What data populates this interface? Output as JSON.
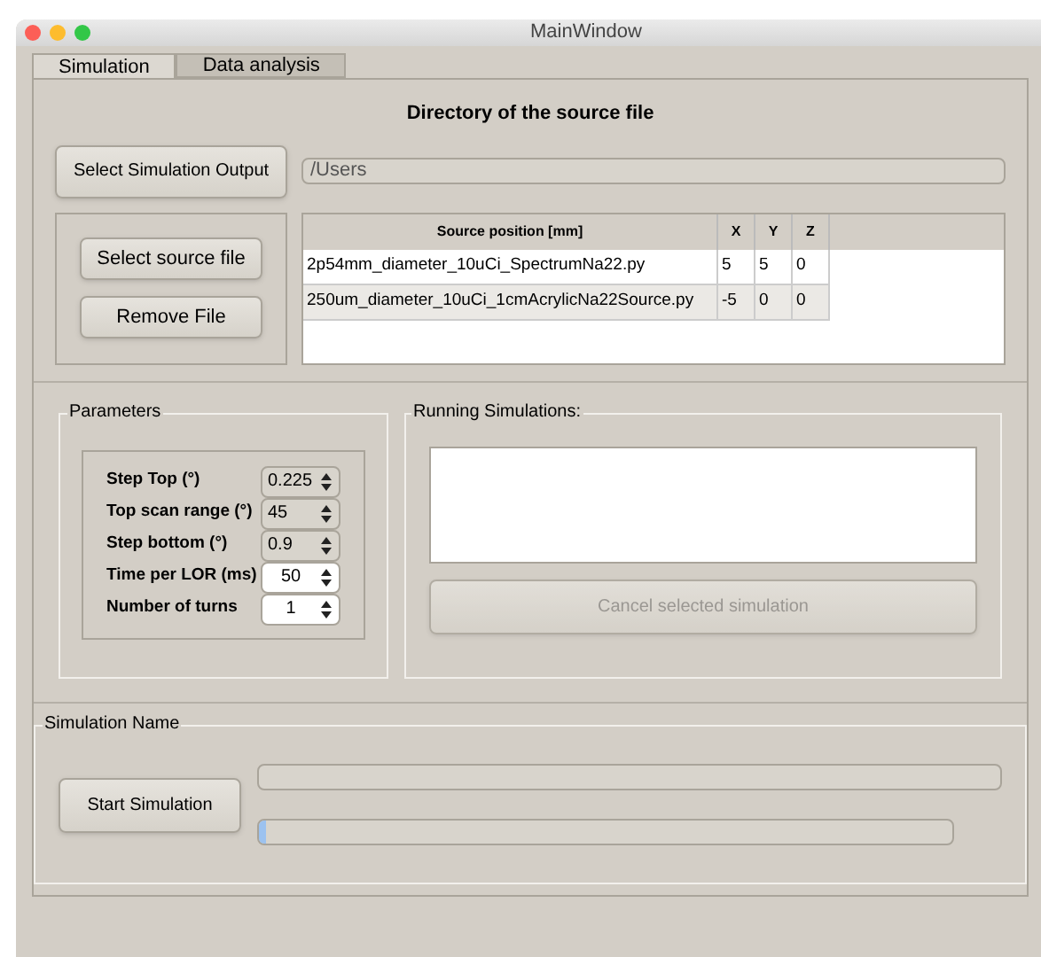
{
  "window": {
    "title": "MainWindow"
  },
  "tabs": [
    {
      "label": "Simulation",
      "selected": true
    },
    {
      "label": "Data analysis",
      "selected": false
    }
  ],
  "source": {
    "heading": "Directory of the source file",
    "output_button": "Select Simulation Output",
    "output_path": "/Users",
    "select_button": "Select source file",
    "remove_button": "Remove File",
    "table": {
      "columns": [
        "Source position [mm]",
        "X",
        "Y",
        "Z"
      ],
      "rows": [
        {
          "cells": [
            "2p54mm_diameter_10uCi_SpectrumNa22.py",
            "5",
            "5",
            "0"
          ],
          "selected": false
        },
        {
          "cells": [
            "250um_diameter_10uCi_1cmAcrylicNa22Source.py",
            "-5",
            "0",
            "0"
          ],
          "selected": true
        }
      ]
    }
  },
  "parameters": {
    "title": "Parameters",
    "fields": [
      {
        "label": "Step Top (°)",
        "value": "0.225",
        "disabled": true
      },
      {
        "label": "Top scan range (°)",
        "value": "45",
        "disabled": true
      },
      {
        "label": "Step bottom (°)",
        "value": "0.9",
        "disabled": true
      },
      {
        "label": "Time per LOR (ms)",
        "value": "50",
        "disabled": false
      },
      {
        "label": "Number of turns",
        "value": "1",
        "disabled": false
      }
    ]
  },
  "running": {
    "title": "Running Simulations:",
    "cancel_button": {
      "label": "Cancel selected simulation",
      "disabled": true
    }
  },
  "simulation": {
    "title": "Simulation Name",
    "start_button": "Start Simulation",
    "progress": {
      "level": 0.01
    }
  }
}
